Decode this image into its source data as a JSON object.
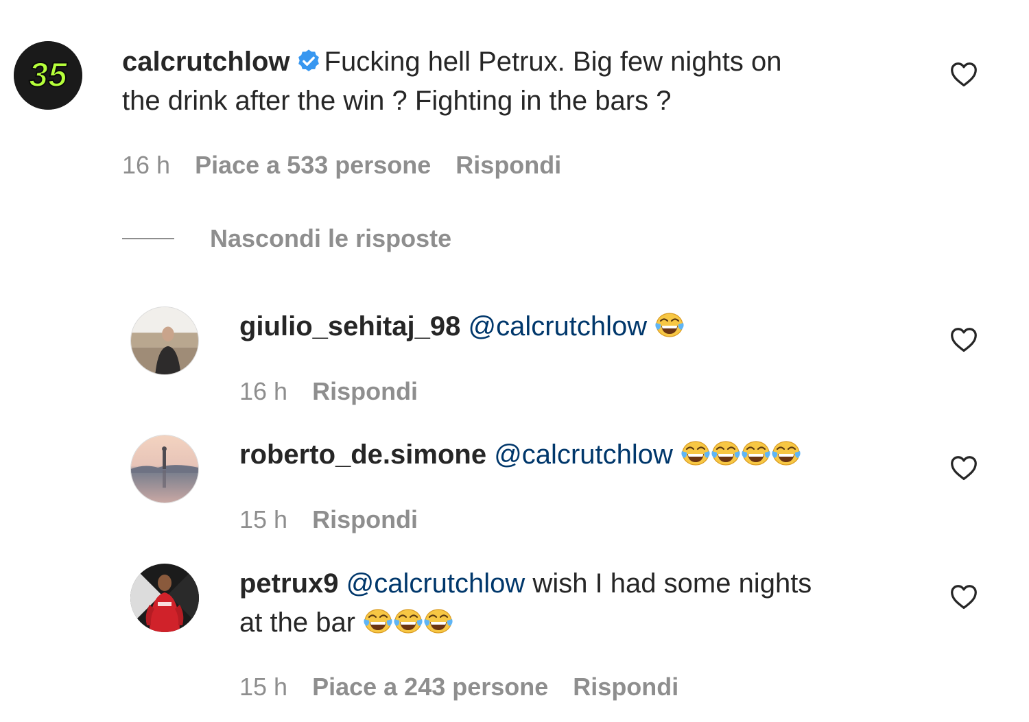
{
  "main_comment": {
    "avatar_text": "35",
    "username": "calcrutchlow",
    "verified": true,
    "text_line1": "Fucking hell Petrux. Big few nights on",
    "text_line2": "the drink after the win ? Fighting in the bars ?",
    "time": "16 h",
    "likes": "Piace a 533 persone",
    "reply": "Rispondi"
  },
  "toggle_replies": {
    "label": "Nascondi le risposte"
  },
  "replies": [
    {
      "username": "giulio_sehitaj_98",
      "mention": "@calcrutchlow",
      "text": "",
      "emoji": [
        "face-with-tears-of-joy"
      ],
      "time": "16 h",
      "reply": "Rispondi"
    },
    {
      "username": "roberto_de.simone",
      "mention": "@calcrutchlow",
      "text": "",
      "emoji": [
        "face-with-tears-of-joy",
        "face-with-tears-of-joy",
        "face-with-tears-of-joy",
        "face-with-tears-of-joy"
      ],
      "time": "15 h",
      "reply": "Rispondi"
    },
    {
      "username": "petrux9",
      "mention": "@calcrutchlow",
      "text_line1": " wish I had some nights",
      "text_line2": "at the bar",
      "emoji": [
        "face-with-tears-of-joy",
        "face-with-tears-of-joy",
        "face-with-tears-of-joy"
      ],
      "time": "15 h",
      "likes": "Piace a 243 persone",
      "reply": "Rispondi"
    }
  ],
  "colors": {
    "username": "#262626",
    "mention": "#00376b",
    "meta": "#8e8e8e",
    "verified": "#3897f0",
    "avatar_accent": "#b6ff3b"
  }
}
